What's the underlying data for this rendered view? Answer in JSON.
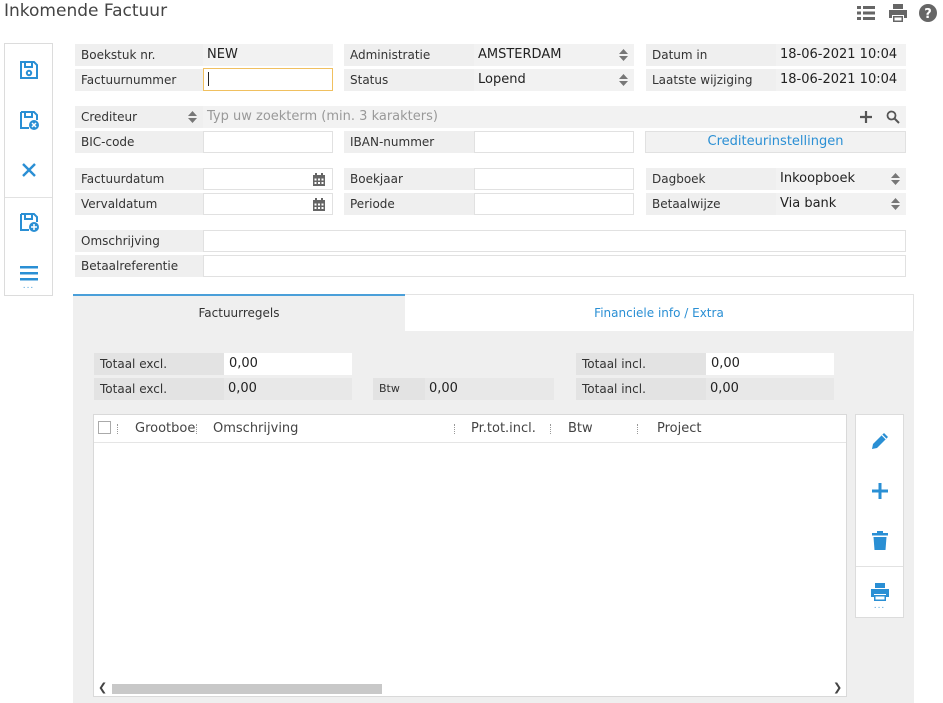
{
  "header": {
    "title": "Inkomende Factuur",
    "icons": [
      "list-icon",
      "print-icon",
      "help-icon"
    ]
  },
  "toolbar": {
    "icons": [
      "save-icon",
      "save-close-icon",
      "cancel-icon",
      "save-new-icon",
      "menu-icon"
    ],
    "more": "..."
  },
  "form": {
    "boekstuk_label": "Boekstuk nr.",
    "boekstuk_value": "NEW",
    "factuurnummer_label": "Factuurnummer",
    "factuurnummer_value": "",
    "administratie_label": "Administratie",
    "administratie_value": "AMSTERDAM",
    "status_label": "Status",
    "status_value": "Lopend",
    "datum_in_label": "Datum in",
    "datum_in_value": "18-06-2021 10:04",
    "laatste_wijziging_label": "Laatste wijziging",
    "laatste_wijziging_value": "18-06-2021 10:04",
    "crediteur_label": "Crediteur",
    "crediteur_placeholder": "Typ uw zoekterm (min. 3 karakters)",
    "bic_label": "BIC-code",
    "bic_value": "",
    "iban_label": "IBAN-nummer",
    "iban_value": "",
    "crediteurinstellingen_label": "Crediteurinstellingen",
    "factuurdatum_label": "Factuurdatum",
    "factuurdatum_value": "",
    "vervaldatum_label": "Vervaldatum",
    "vervaldatum_value": "",
    "boekjaar_label": "Boekjaar",
    "boekjaar_value": "",
    "periode_label": "Periode",
    "periode_value": "",
    "dagboek_label": "Dagboek",
    "dagboek_value": "Inkoopboek",
    "betaalwijze_label": "Betaalwijze",
    "betaalwijze_value": "Via bank",
    "omschrijving_label": "Omschrijving",
    "omschrijving_value": "",
    "betaalreferentie_label": "Betaalreferentie",
    "betaalreferentie_value": ""
  },
  "tabs": [
    {
      "label": "Factuurregels",
      "active": true
    },
    {
      "label": "Financiele info / Extra",
      "active": false
    }
  ],
  "totals": {
    "excl_label_1": "Totaal excl.",
    "excl_value_1": "0,00",
    "excl_label_2": "Totaal excl.",
    "excl_value_2": "0,00",
    "btw_label": "Btw",
    "btw_value": "0,00",
    "incl_label_1": "Totaal incl.",
    "incl_value_1": "0,00",
    "incl_label_2": "Totaal incl.",
    "incl_value_2": "0,00"
  },
  "grid": {
    "columns": [
      "Grootboe",
      "Omschrijving",
      "Pr.tot.incl.",
      "Btw",
      "Project"
    ],
    "rows": []
  },
  "actions": {
    "icons": [
      "edit-icon",
      "add-icon",
      "delete-icon",
      "print-icon"
    ],
    "more": "..."
  },
  "colors": {
    "accent": "#2a8fd4",
    "label_bg": "#efefef",
    "focus_border": "#f0c060"
  }
}
